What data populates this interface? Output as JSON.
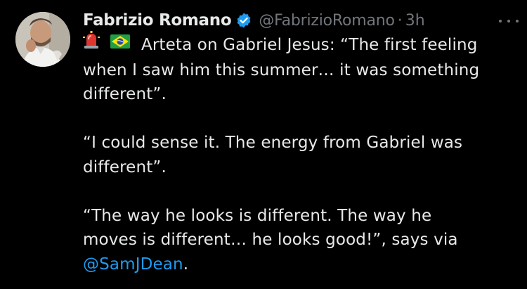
{
  "tweet": {
    "author": {
      "name": "Fabrizio Romano",
      "handle": "@FabrizioRomano",
      "separator": "·",
      "time": "3h",
      "verified": true,
      "verified_color": "#1d9bf0"
    },
    "emojis": [
      "rotating-light-emoji",
      "brazil-flag-emoji"
    ],
    "lines": [
      "Arteta on Gabriel Jesus: “The first feeling",
      "when I saw him this summer… it was something",
      "different”.",
      "“I could sense it. The energy from Gabriel was",
      "different”.",
      "“The way he looks is different. The way he",
      "moves is different… he looks good!”, says via"
    ],
    "mention": "@SamJDean",
    "after_mention": ".",
    "colors": {
      "background": "#000000",
      "text": "#e7e9ea",
      "muted": "#71767b",
      "link": "#1d9bf0"
    }
  }
}
